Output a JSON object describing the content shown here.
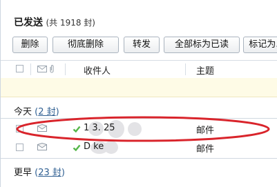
{
  "folder": {
    "title": "已发送",
    "count_text": "(共 1918 封)"
  },
  "toolbar": {
    "delete": "删除",
    "purge": "彻底删除",
    "forward": "转发",
    "mark_all_read": "全部标为已读",
    "mark_as": "标记为..."
  },
  "columns": {
    "recipient": "收件人",
    "subject": "主题"
  },
  "groups": {
    "today": {
      "label": "今天",
      "open": "(",
      "count": "2 封",
      "close": ")"
    },
    "earlier": {
      "label": "更早",
      "open": "(",
      "count": "23 封",
      "close": ")"
    }
  },
  "messages": [
    {
      "recipient": "1   3.   25",
      "subject": "邮件"
    },
    {
      "recipient": "D       ke",
      "subject": "邮件"
    }
  ],
  "colors": {
    "annotation": "#d9242b",
    "link": "#2f5f92",
    "notice_bg": "#fefbe6",
    "check_green": "#54b648"
  },
  "icons": [
    "envelope-icon",
    "attachment-icon",
    "sent-check-icon"
  ]
}
